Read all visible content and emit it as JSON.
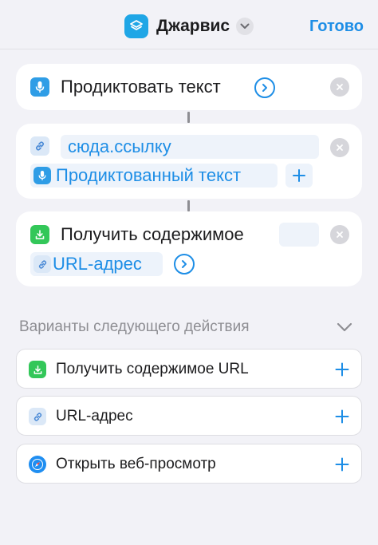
{
  "header": {
    "app_title": "Джарвис",
    "done_label": "Готово",
    "app_icon": "shortcuts-layers-icon",
    "accent_color": "#1e8ee6"
  },
  "actions": [
    {
      "icon": "microphone-icon",
      "label": "Продиктовать текст"
    },
    {
      "icon": "link-icon",
      "url_text": "сюда.ссылку",
      "variable_label": "Продиктованный текст",
      "variable_icon": "microphone-icon"
    },
    {
      "icon": "download-icon",
      "label": "Получить содержимое",
      "variable_label": "URL-адрес",
      "variable_icon": "link-icon"
    }
  ],
  "suggestions": {
    "title": "Варианты следующего действия",
    "items": [
      {
        "icon": "download-icon",
        "label": "Получить содержимое URL"
      },
      {
        "icon": "link-icon",
        "label": "URL-адрес"
      },
      {
        "icon": "compass-icon",
        "label": "Открыть веб-просмотр"
      }
    ]
  }
}
